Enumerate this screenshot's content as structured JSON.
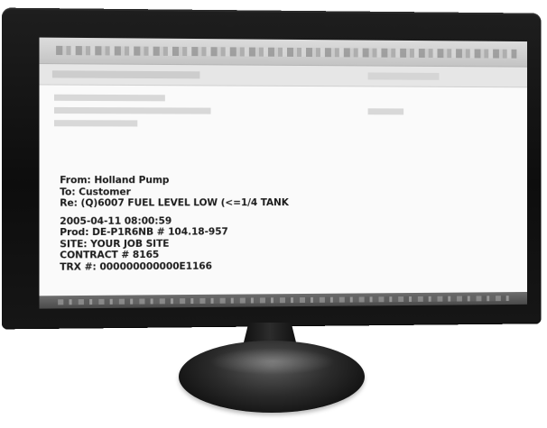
{
  "message": {
    "from_line": "From: Holland Pump",
    "to_line": "To: Customer",
    "re_line": "Re: (Q)6007 FUEL LEVEL LOW (<=1/4 TANK",
    "timestamp": "2005-04-11 08:00:59",
    "prod_line": "Prod: DE-P1R6NB # 104.18-957",
    "site_line": "SITE: YOUR JOB SITE",
    "contract_line": "CONTRACT # 8165",
    "trx_line": "TRX #: 000000000000E1166"
  }
}
